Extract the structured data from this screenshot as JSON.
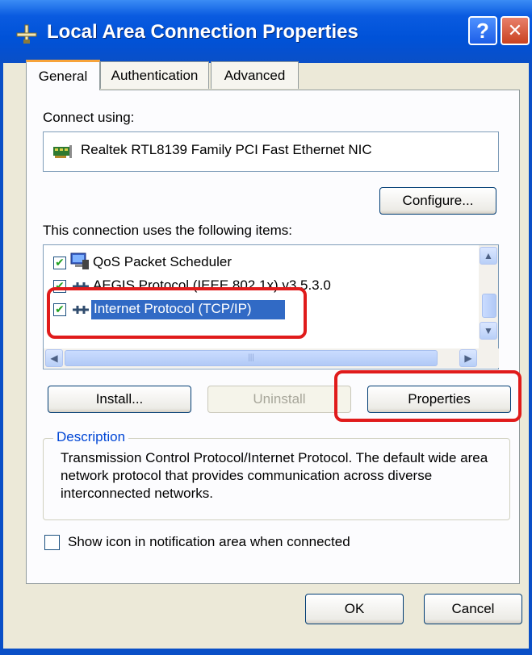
{
  "window": {
    "title": "Local Area Connection Properties",
    "help_glyph": "?",
    "close_glyph": "✕"
  },
  "tabs": [
    {
      "label": "General",
      "active": true
    },
    {
      "label": "Authentication",
      "active": false
    },
    {
      "label": "Advanced",
      "active": false
    }
  ],
  "general": {
    "connect_using_label": "Connect using:",
    "adapter_name": "Realtek RTL8139 Family PCI Fast Ethernet NIC",
    "configure_label": "Configure...",
    "items_label": "This connection uses the following items:",
    "items": [
      {
        "label": "QoS Packet Scheduler",
        "checked": true,
        "icon": "qos-scheduler-icon"
      },
      {
        "label": "AEGIS Protocol (IEEE 802.1x) v3.5.3.0",
        "checked": true,
        "icon": "network-protocol-icon"
      },
      {
        "label": "Internet Protocol (TCP/IP)",
        "checked": true,
        "icon": "network-protocol-icon",
        "selected": true
      }
    ],
    "check_glyph": "✔",
    "buttons": {
      "install": "Install...",
      "uninstall": "Uninstall",
      "properties": "Properties"
    },
    "description_title": "Description",
    "description_text": "Transmission Control Protocol/Internet Protocol. The default wide area network protocol that provides communication across diverse interconnected networks.",
    "show_icon_label": "Show icon in notification area when connected",
    "show_icon_checked": false
  },
  "footer": {
    "ok": "OK",
    "cancel": "Cancel"
  },
  "colors": {
    "titlebar": "#0052d8",
    "selection": "#316ac5",
    "highlight_annotation": "#e01b1b",
    "description_title": "#0046d5"
  }
}
